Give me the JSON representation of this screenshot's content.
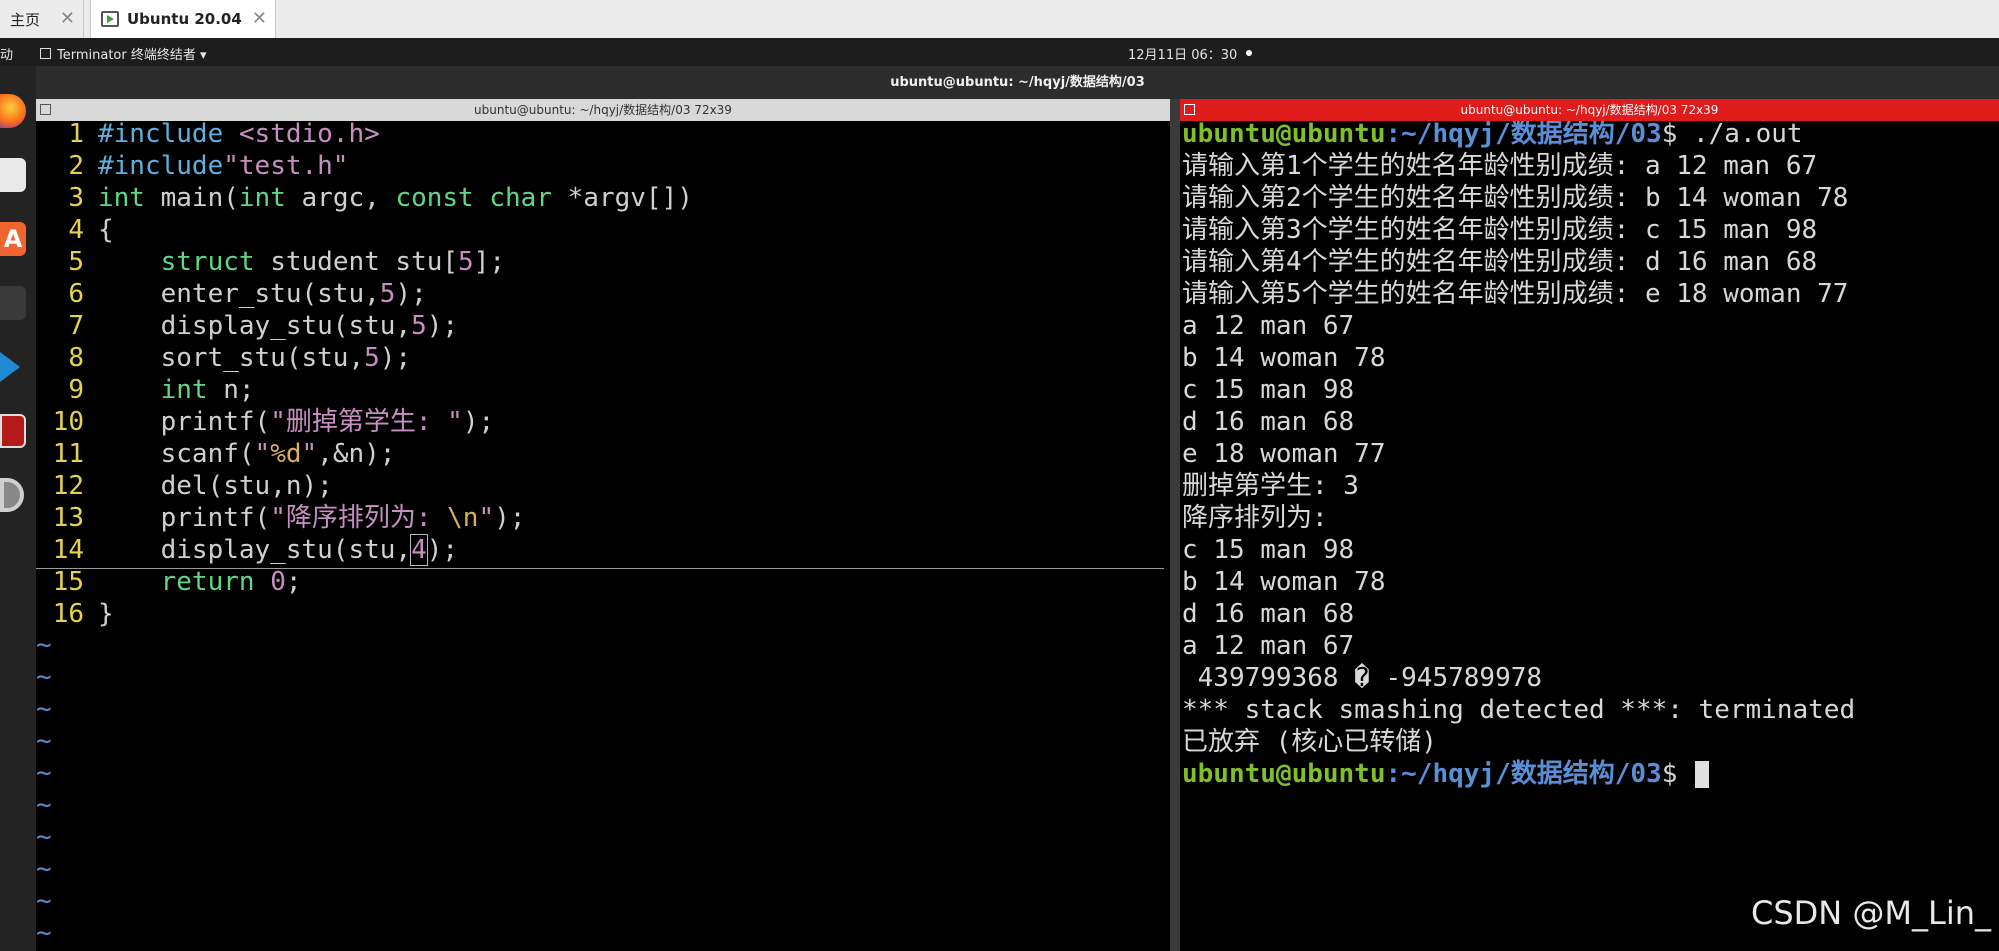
{
  "host_tabs": {
    "home_label": "主页",
    "vm_label": "Ubuntu 20.04",
    "close_glyph": "✕"
  },
  "top_panel": {
    "activities": "动",
    "app_menu": "Terminator 终端终结者 ▾",
    "clock": "12月11日 06：30"
  },
  "window": {
    "title": "ubuntu@ubuntu: ~/hqyj/数据结构/03"
  },
  "dock": {
    "items": [
      "firefox-icon",
      "files-icon",
      "software-icon",
      "terminal-icon",
      "vscode-icon",
      "terminator-icon",
      "settings-icon"
    ],
    "software_glyph": "A"
  },
  "left_pane": {
    "title": "ubuntu@ubuntu: ~/hqyj/数据结构/03 72x39",
    "line_numbers": [
      "1",
      "2",
      "3",
      "4",
      "5",
      "6",
      "7",
      "8",
      "9",
      "10",
      "11",
      "12",
      "13",
      "14",
      "15",
      "16"
    ],
    "tilde": "~"
  },
  "right_pane": {
    "title": "ubuntu@ubuntu: ~/hqyj/数据结构/03 72x39",
    "prompt_user": "ubuntu@ubuntu",
    "prompt_path": ":~/hqyj/数据结构/03",
    "prompt_symbol": "$ ",
    "command": "./a.out",
    "output": [
      "请输入第1个学生的姓名年龄性别成绩: a 12 man 67",
      "请输入第2个学生的姓名年龄性别成绩: b 14 woman 78",
      "请输入第3个学生的姓名年龄性别成绩: c 15 man 98",
      "请输入第4个学生的姓名年龄性别成绩: d 16 man 68",
      "请输入第5个学生的姓名年龄性别成绩: e 18 woman 77",
      "a 12 man 67",
      "b 14 woman 78",
      "c 15 man 98",
      "d 16 man 68",
      "e 18 woman 77",
      "删掉第学生: 3",
      "降序排列为:",
      "c 15 man 98",
      "b 14 woman 78",
      "d 16 man 68",
      "a 12 man 67",
      " 439799368 � -945789978",
      "*** stack smashing detected ***: terminated",
      "已放弃 (核心已转储)"
    ]
  },
  "watermark": "CSDN @M_Lin_"
}
